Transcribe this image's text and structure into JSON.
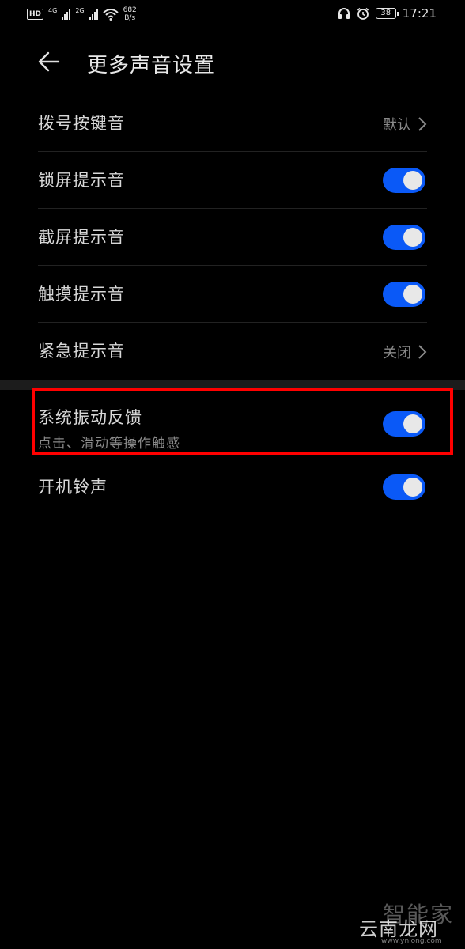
{
  "status_bar": {
    "hd": "HD",
    "net1": "4G",
    "net2": "2G",
    "speed_value": "682",
    "speed_unit": "B/s",
    "battery": "38",
    "time": "17:21"
  },
  "header": {
    "title": "更多声音设置"
  },
  "settings": [
    {
      "label": "拨号按键音",
      "value": "默认"
    },
    {
      "label": "锁屏提示音",
      "toggle_on": true
    },
    {
      "label": "截屏提示音",
      "toggle_on": true
    },
    {
      "label": "触摸提示音",
      "toggle_on": true
    },
    {
      "label": "紧急提示音",
      "value": "关闭"
    }
  ],
  "settings2": [
    {
      "label": "系统振动反馈",
      "sublabel": "点击、滑动等操作触感",
      "toggle_on": true
    },
    {
      "label": "开机铃声",
      "toggle_on": true
    }
  ],
  "colors": {
    "accent": "#0a59f7",
    "highlight": "#ff0000",
    "background": "#000000"
  },
  "watermark": {
    "top": "智能家",
    "main": "云南龙网",
    "sub": "www.ynlong.com"
  }
}
